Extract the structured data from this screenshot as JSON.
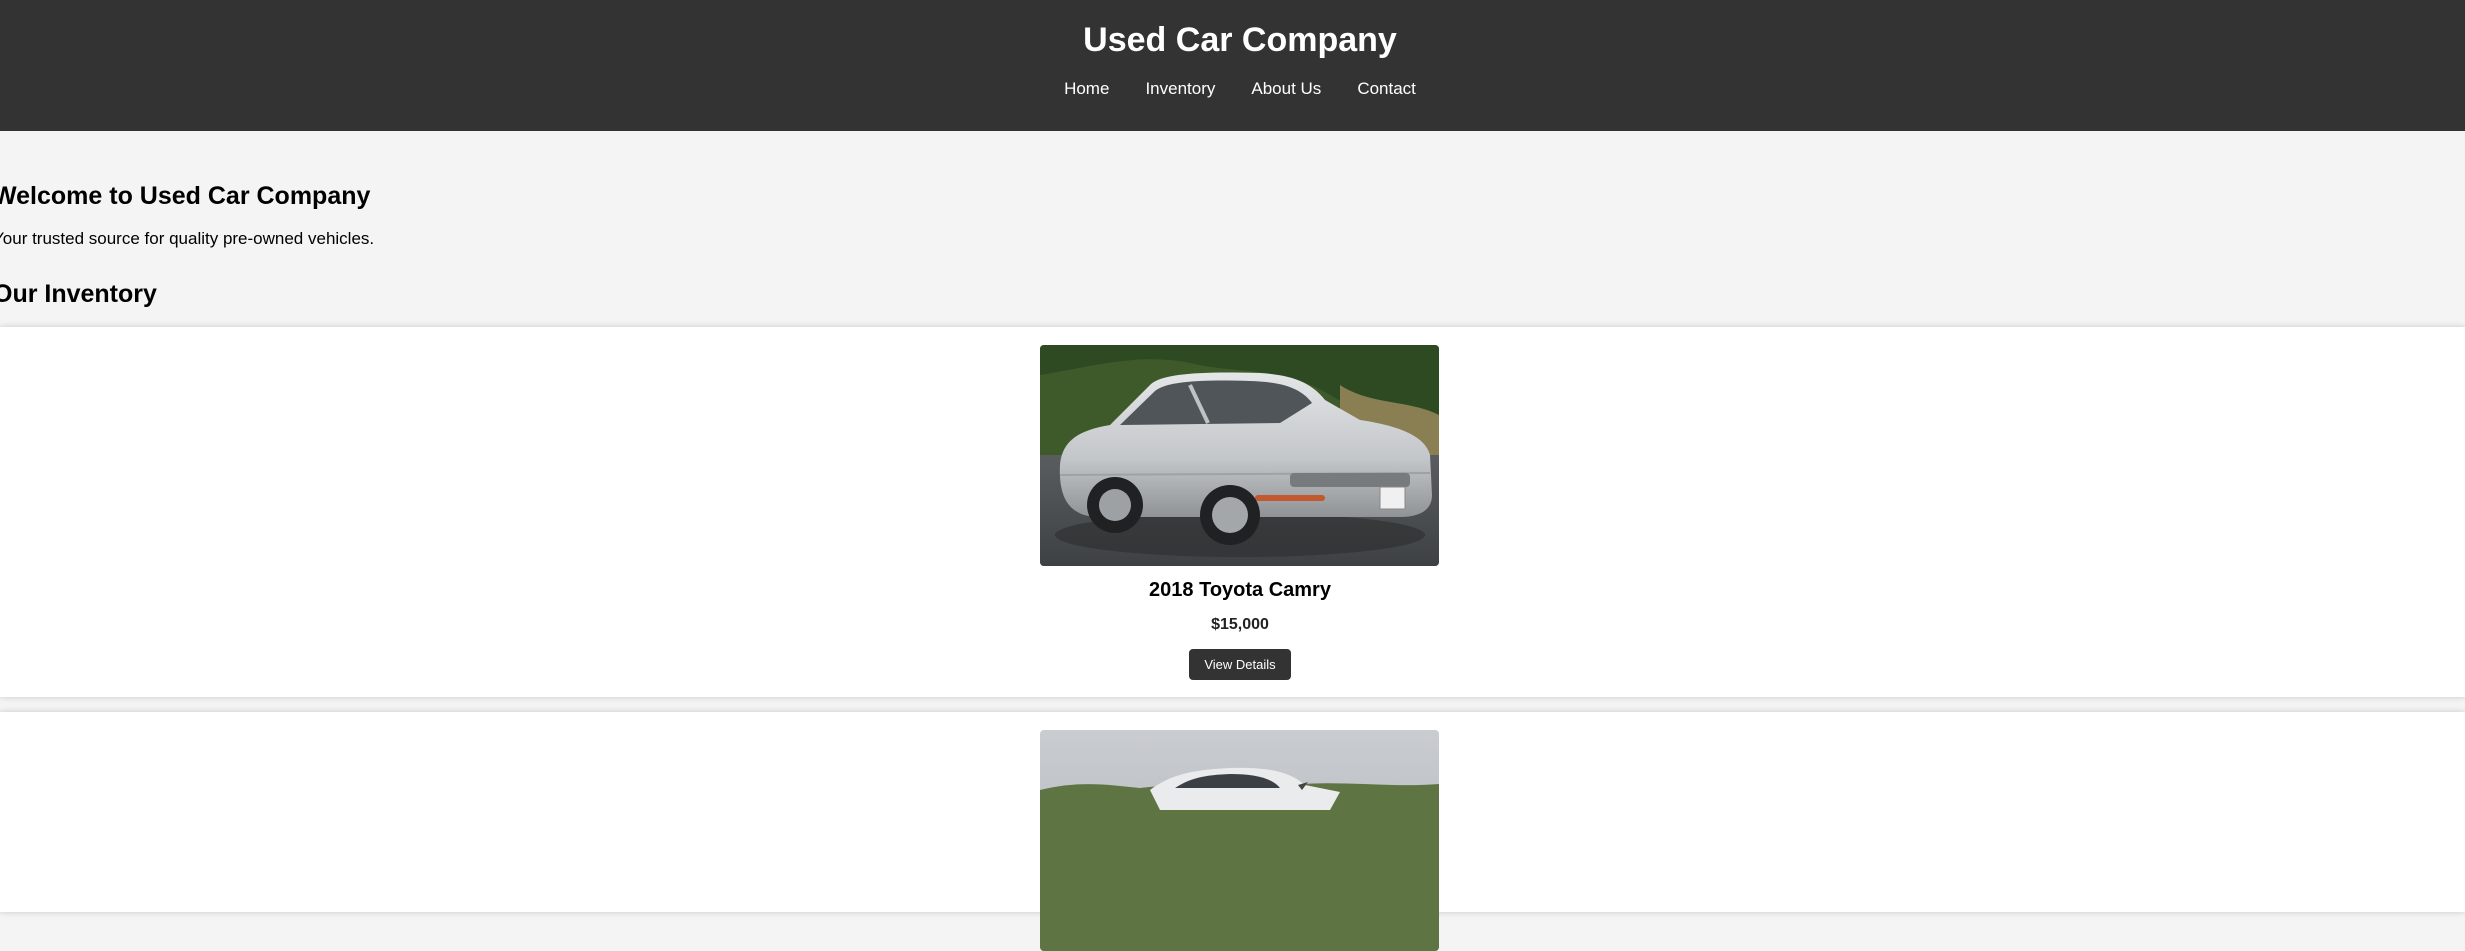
{
  "header": {
    "title": "Used Car Company",
    "nav": [
      "Home",
      "Inventory",
      "About Us",
      "Contact"
    ]
  },
  "intro": {
    "heading": "Welcome to Used Car Company",
    "text": "Your trusted source for quality pre-owned vehicles."
  },
  "inventory": {
    "heading": "Our Inventory",
    "cars": [
      {
        "title": "2018 Toyota Camry",
        "price": "$15,000",
        "button_label": "View Details"
      }
    ]
  },
  "colors": {
    "header_bg": "#333333",
    "page_bg": "#f4f4f4",
    "card_bg": "#ffffff",
    "button_bg": "#333333"
  }
}
